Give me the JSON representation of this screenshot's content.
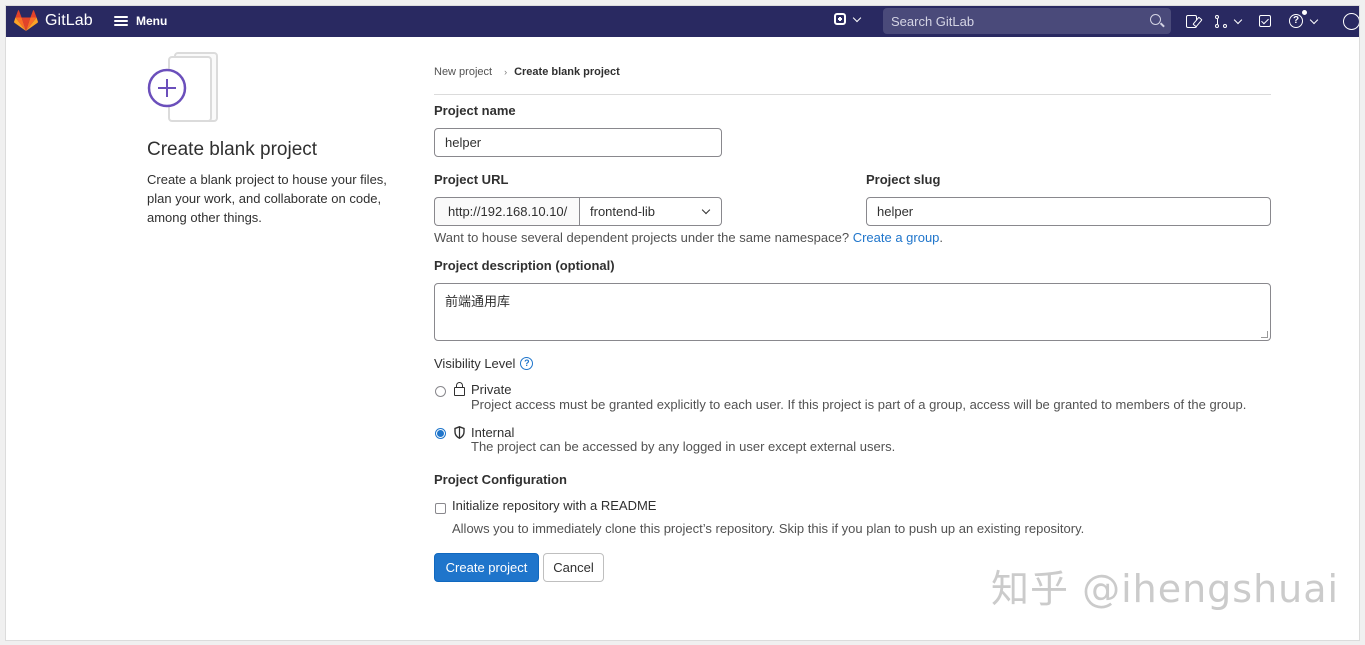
{
  "navbar": {
    "brand": "GitLab",
    "menu_label": "Menu",
    "search_placeholder": "Search GitLab",
    "bg_color": "#292961",
    "icons": [
      "plus-square-icon",
      "issues-icon",
      "merge-request-icon",
      "todo-icon",
      "help-icon",
      "user-avatar"
    ]
  },
  "left": {
    "title": "Create blank project",
    "description": "Create a blank project to house your files, plan your work, and collaborate on code, among other things."
  },
  "breadcrumb": {
    "parent": "New project",
    "separator": "›",
    "current": "Create blank project"
  },
  "form": {
    "project_name_label": "Project name",
    "project_name_value": "helper",
    "project_url_label": "Project URL",
    "url_prefix": "http://192.168.10.10/",
    "namespace_value": "frontend-lib",
    "project_slug_label": "Project slug",
    "project_slug_value": "helper",
    "hint_text": "Want to house several dependent projects under the same namespace?",
    "hint_link": "Create a group",
    "hint_end": ".",
    "description_label": "Project description (optional)",
    "description_value": "前端通用库",
    "visibility_label": "Visibility Level",
    "visibility_help": "?",
    "visibility_options": [
      {
        "title": "Private",
        "desc": "Project access must be granted explicitly to each user. If this project is part of a group, access will be granted to members of the group.",
        "checked": false,
        "icon": "lock-icon"
      },
      {
        "title": "Internal",
        "desc": "The project can be accessed by any logged in user except external users.",
        "checked": true,
        "icon": "shield-icon"
      }
    ],
    "config_label": "Project Configuration",
    "readme_label": "Initialize repository with a README",
    "readme_desc": "Allows you to immediately clone this project’s repository. Skip this if you plan to push up an existing repository.",
    "readme_checked": false,
    "create_button": "Create project",
    "cancel_button": "Cancel"
  },
  "watermark": "知乎 @ihengshuai",
  "colors": {
    "primary": "#1f75cb",
    "nav": "#292961",
    "text": "#303030"
  }
}
